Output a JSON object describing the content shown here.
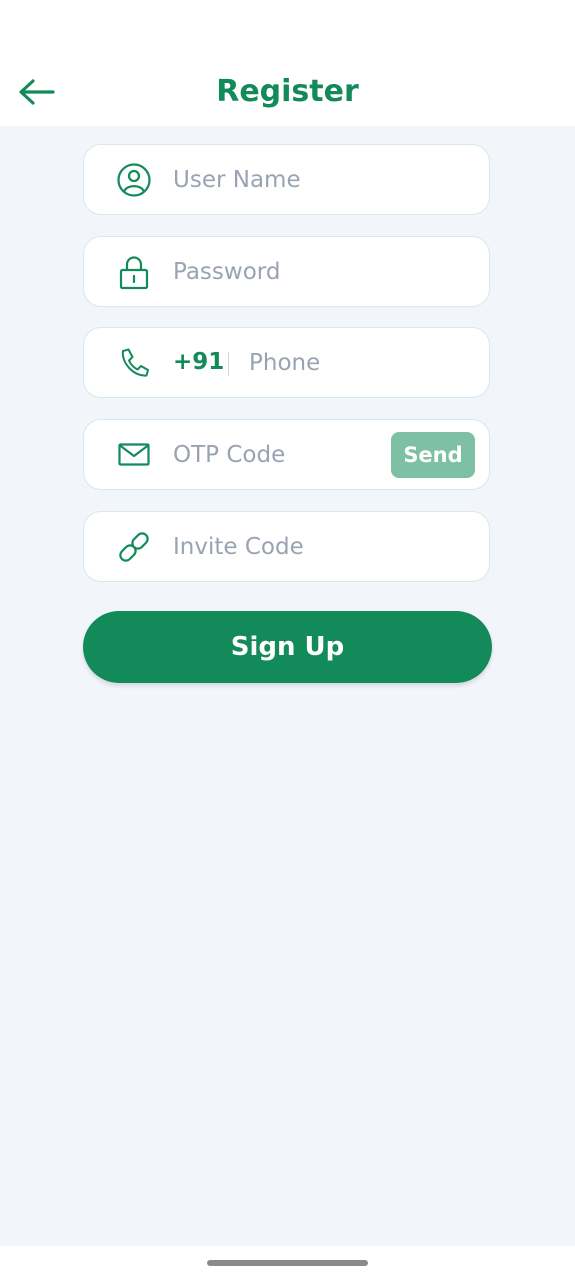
{
  "header": {
    "title": "Register",
    "back_icon": "arrow-left-icon"
  },
  "form": {
    "username": {
      "placeholder": "User Name",
      "icon": "user-icon"
    },
    "password": {
      "placeholder": "Password",
      "icon": "lock-icon"
    },
    "phone": {
      "country_code": "+91",
      "placeholder": "Phone",
      "icon": "phone-icon"
    },
    "otp": {
      "placeholder": "OTP Code",
      "send_label": "Send",
      "icon": "mail-icon"
    },
    "invite": {
      "placeholder": "Invite Code",
      "icon": "link-icon"
    },
    "signup_label": "Sign Up"
  },
  "colors": {
    "brand": "#138a5a",
    "send_button": "#7ec0a6",
    "background": "#f2f6fb",
    "placeholder": "#9aa3b2"
  }
}
